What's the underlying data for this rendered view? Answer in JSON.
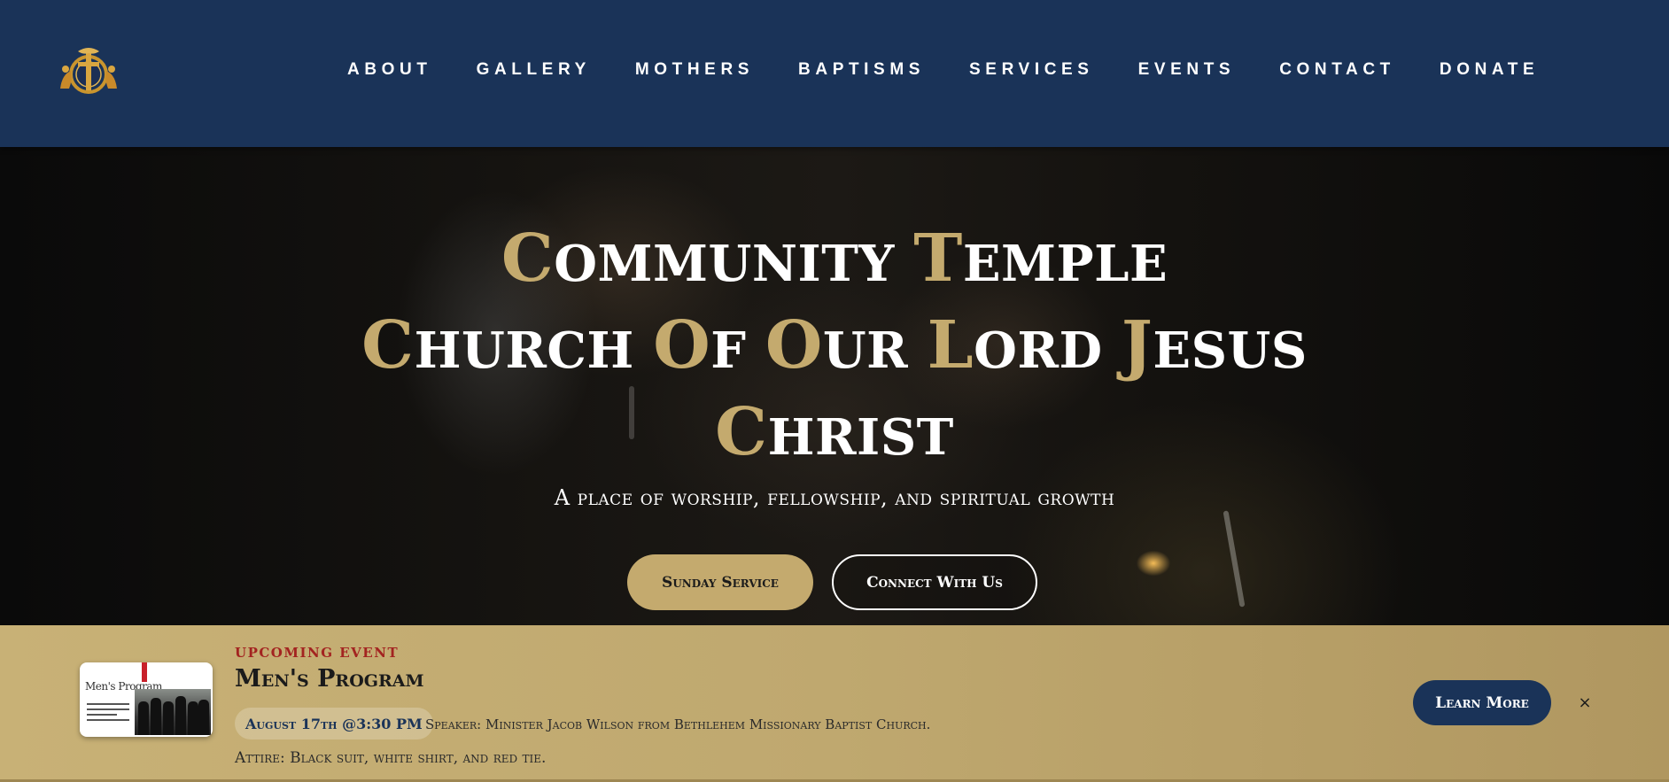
{
  "header": {
    "logo_icon": "church-crest-icon",
    "nav": [
      {
        "label": "ABOUT"
      },
      {
        "label": "GALLERY"
      },
      {
        "label": "MOTHERS"
      },
      {
        "label": "BAPTISMS"
      },
      {
        "label": "SERVICES"
      },
      {
        "label": "EVENTS"
      },
      {
        "label": "CONTACT"
      },
      {
        "label": "DONATE"
      }
    ]
  },
  "hero": {
    "title_line1": [
      {
        "cap": "C",
        "rest": "ommunity"
      },
      {
        "cap": "T",
        "rest": "emple"
      }
    ],
    "title_line2": [
      {
        "cap": "C",
        "rest": "hurch"
      },
      {
        "cap": "O",
        "rest": "f"
      },
      {
        "cap": "O",
        "rest": "ur"
      },
      {
        "cap": "L",
        "rest": "ord"
      },
      {
        "cap": "J",
        "rest": "esus"
      }
    ],
    "title_line3": [
      {
        "cap": "C",
        "rest": "hrist"
      }
    ],
    "subtitle": "A place of worship, fellowship, and spiritual growth",
    "primary_button": "Sunday Service",
    "secondary_button": "Connect With Us"
  },
  "event": {
    "label": "UPCOMING EVENT",
    "title": "Men's Program",
    "thumbnail_title": "Men's Program",
    "date": "August 17th @3:30 PM",
    "speaker": "Speaker: Minister Jacob Wilson from Bethlehem Missionary Baptist Church.",
    "attire": "Attire: Black suit, white shirt, and red tie.",
    "learn_more": "Learn More",
    "close_symbol": "×",
    "close_icon": "close-icon"
  },
  "colors": {
    "header_bg": "#1a3358",
    "gold": "#c4aa6e",
    "event_label": "#a32320"
  }
}
